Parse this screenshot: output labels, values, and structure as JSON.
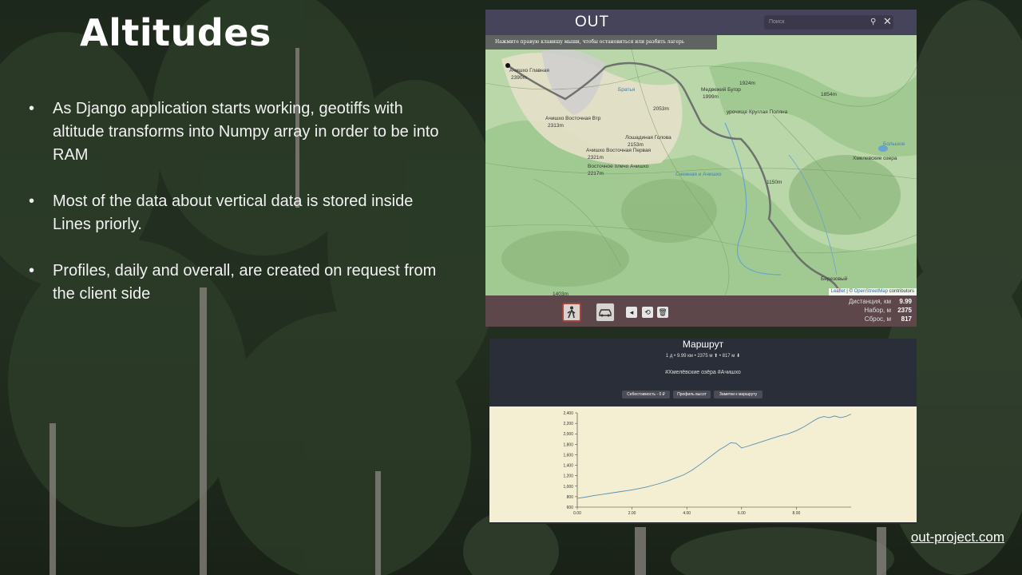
{
  "slide": {
    "title": "Altitudes",
    "bullets": [
      "As Django application starts working, geotiffs with altitude transforms into Numpy array in order to be into RAM",
      "Most of the data about vertical data is stored inside Lines priorly.",
      "Profiles, daily and overall, are created on request from the client side"
    ],
    "footer_link": "out-project.com"
  },
  "app": {
    "title": "OUT",
    "search_placeholder": "Поиск",
    "hint": "Нажмите правую клавишу мыши, чтобы остановиться или разбить лагерь",
    "attribution": {
      "leaflet": "Leaflet",
      "sep": " | © ",
      "osm": "OpenStreetMap",
      "contrib": " contributors"
    },
    "map_labels": [
      {
        "t": "Ачишхо Главная",
        "c": "#333"
      },
      {
        "t": "2390m",
        "c": "#333"
      },
      {
        "t": "Ачишхо Восточная Втр",
        "c": "#333"
      },
      {
        "t": "2313m",
        "c": "#333"
      },
      {
        "t": "Братья",
        "c": "#3b7fc4"
      },
      {
        "t": "2053m",
        "c": "#333"
      },
      {
        "t": "Медвежий Бугор",
        "c": "#333"
      },
      {
        "t": "1999m",
        "c": "#333"
      },
      {
        "t": "1924m",
        "c": "#333"
      },
      {
        "t": "1854m",
        "c": "#333"
      },
      {
        "t": "урочище Круглая Поляна",
        "c": "#333"
      },
      {
        "t": "Лошадиная Голова",
        "c": "#333"
      },
      {
        "t": "2153m",
        "c": "#333"
      },
      {
        "t": "Ачишхо Восточная Первая",
        "c": "#333"
      },
      {
        "t": "2321m",
        "c": "#333"
      },
      {
        "t": "Восточное плечо Ачишхо",
        "c": "#333"
      },
      {
        "t": "2217m",
        "c": "#333"
      },
      {
        "t": "Хмелевские озера",
        "c": "#333"
      },
      {
        "t": "Большое",
        "c": "#3b7fc4"
      },
      {
        "t": "1150m",
        "c": "#333"
      },
      {
        "t": "Снежная и Ачишхо",
        "c": "#3b7fc4"
      },
      {
        "t": "1403m",
        "c": "#333"
      },
      {
        "t": "Березовый",
        "c": "#333"
      }
    ],
    "modes": {
      "walk": "walk-icon",
      "car": "car-icon"
    },
    "tools": {
      "share": "◂",
      "undo": "⟲",
      "delete": "🗑"
    },
    "stats": [
      {
        "label": "Дистанция, км",
        "value": "9.99"
      },
      {
        "label": "Набор, м",
        "value": "2375"
      },
      {
        "label": "Сброс, м",
        "value": "817"
      }
    ]
  },
  "route": {
    "title": "Маршрут",
    "summary": "1 д • 9.99 км • 2375 м ⬆ • 817 м ⬇",
    "tags": "#Хмелёвские озёра #Ачишхо",
    "buttons": [
      "Себестоимость - 0 ₽",
      "Профиль высот",
      "Заметки к маршруту"
    ]
  },
  "chart_data": {
    "type": "line",
    "title": "",
    "xlabel": "",
    "ylabel": "",
    "xlim": [
      0,
      10
    ],
    "ylim": [
      600,
      2400
    ],
    "x_ticks": [
      "0.00",
      "2.00",
      "4.00",
      "6.00",
      "8.00"
    ],
    "x_tick_values": [
      0,
      2,
      4,
      6,
      8
    ],
    "y_ticks": [
      "600",
      "800",
      "1,000",
      "1,200",
      "1,400",
      "1,600",
      "1,800",
      "2,000",
      "2,200",
      "2,400"
    ],
    "y_tick_values": [
      600,
      800,
      1000,
      1200,
      1400,
      1600,
      1800,
      2000,
      2200,
      2400
    ],
    "series": [
      {
        "color": "#5a8fb0",
        "x": [
          0,
          0.3,
          0.6,
          1.0,
          1.5,
          2.0,
          2.5,
          3.0,
          3.3,
          3.6,
          3.9,
          4.2,
          4.5,
          4.8,
          5.0,
          5.2,
          5.4,
          5.6,
          5.8,
          6.0,
          6.2,
          6.5,
          6.8,
          7.1,
          7.4,
          7.7,
          8.0,
          8.3,
          8.6,
          8.8,
          9.0,
          9.2,
          9.4,
          9.6,
          9.8,
          9.99
        ],
        "y": [
          770,
          790,
          820,
          850,
          890,
          930,
          980,
          1050,
          1100,
          1160,
          1220,
          1310,
          1420,
          1540,
          1620,
          1700,
          1760,
          1830,
          1820,
          1730,
          1760,
          1810,
          1860,
          1910,
          1960,
          2000,
          2060,
          2140,
          2240,
          2300,
          2330,
          2310,
          2340,
          2310,
          2330,
          2375
        ]
      }
    ]
  }
}
